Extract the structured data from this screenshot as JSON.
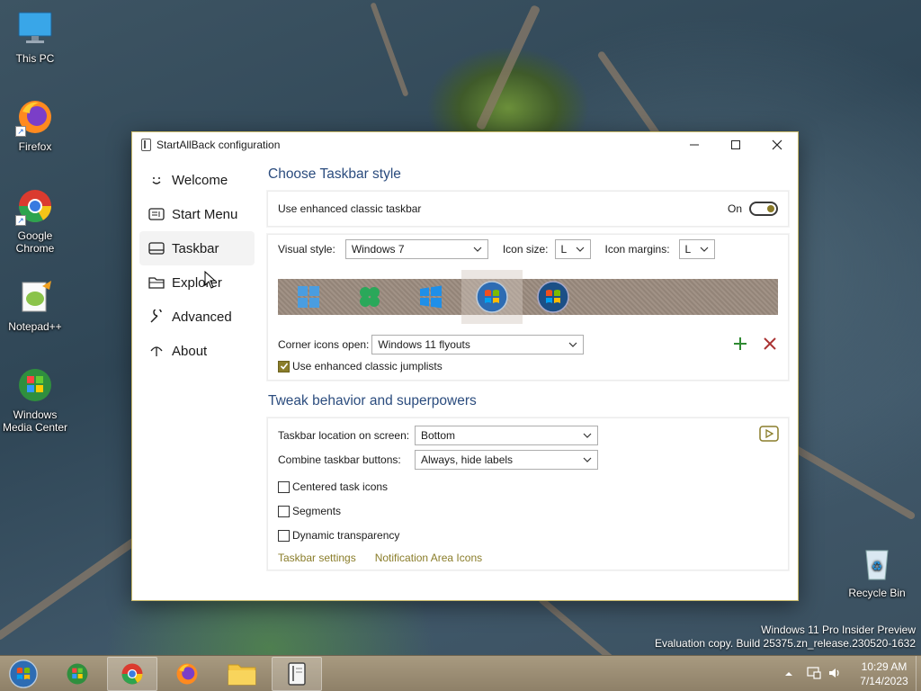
{
  "desktop": {
    "icons": [
      {
        "label": "This PC"
      },
      {
        "label": "Firefox"
      },
      {
        "label": "Google Chrome"
      },
      {
        "label": "Notepad++"
      },
      {
        "label": "Windows Media Center"
      },
      {
        "label": "Recycle Bin"
      }
    ],
    "watermark_line1": "Windows 11 Pro Insider Preview",
    "watermark_line2": "Evaluation copy. Build 25375.zn_release.230520-1632"
  },
  "window": {
    "title": "StartAllBack configuration",
    "sidebar": [
      {
        "label": "Welcome",
        "icon": "smile-icon"
      },
      {
        "label": "Start Menu",
        "icon": "start-menu-icon"
      },
      {
        "label": "Taskbar",
        "icon": "taskbar-icon"
      },
      {
        "label": "Explorer",
        "icon": "folder-icon"
      },
      {
        "label": "Advanced",
        "icon": "wrench-icon"
      },
      {
        "label": "About",
        "icon": "about-icon"
      }
    ],
    "section1_title": "Choose Taskbar style",
    "enhanced_taskbar": {
      "label": "Use enhanced classic taskbar",
      "state": "On"
    },
    "visual_style": {
      "label": "Visual style:",
      "value": "Windows 7"
    },
    "icon_size": {
      "label": "Icon size:",
      "value": "L"
    },
    "icon_margins": {
      "label": "Icon margins:",
      "value": "L"
    },
    "preview_styles": [
      "Windows 11",
      "Windows 10 flower",
      "Windows 10",
      "Windows 7",
      "Windows Vista"
    ],
    "corner_icons": {
      "label": "Corner icons open:",
      "value": "Windows 11 flyouts"
    },
    "jumplists": {
      "label": "Use enhanced classic jumplists",
      "checked": true
    },
    "section2_title": "Tweak behavior and superpowers",
    "taskbar_location": {
      "label": "Taskbar location on screen:",
      "value": "Bottom"
    },
    "combine_buttons": {
      "label": "Combine taskbar buttons:",
      "value": "Always, hide labels"
    },
    "centered": {
      "label": "Centered task icons",
      "checked": false
    },
    "segments": {
      "label": "Segments",
      "checked": false
    },
    "transparency": {
      "label": "Dynamic transparency",
      "checked": false
    },
    "link_taskbar_settings": "Taskbar settings",
    "link_notification_icons": "Notification Area Icons"
  },
  "taskbar": {
    "time": "10:29 AM",
    "date": "7/14/2023"
  },
  "colors": {
    "accent": "#8a7d2a",
    "section_title": "#2b4c7e"
  }
}
